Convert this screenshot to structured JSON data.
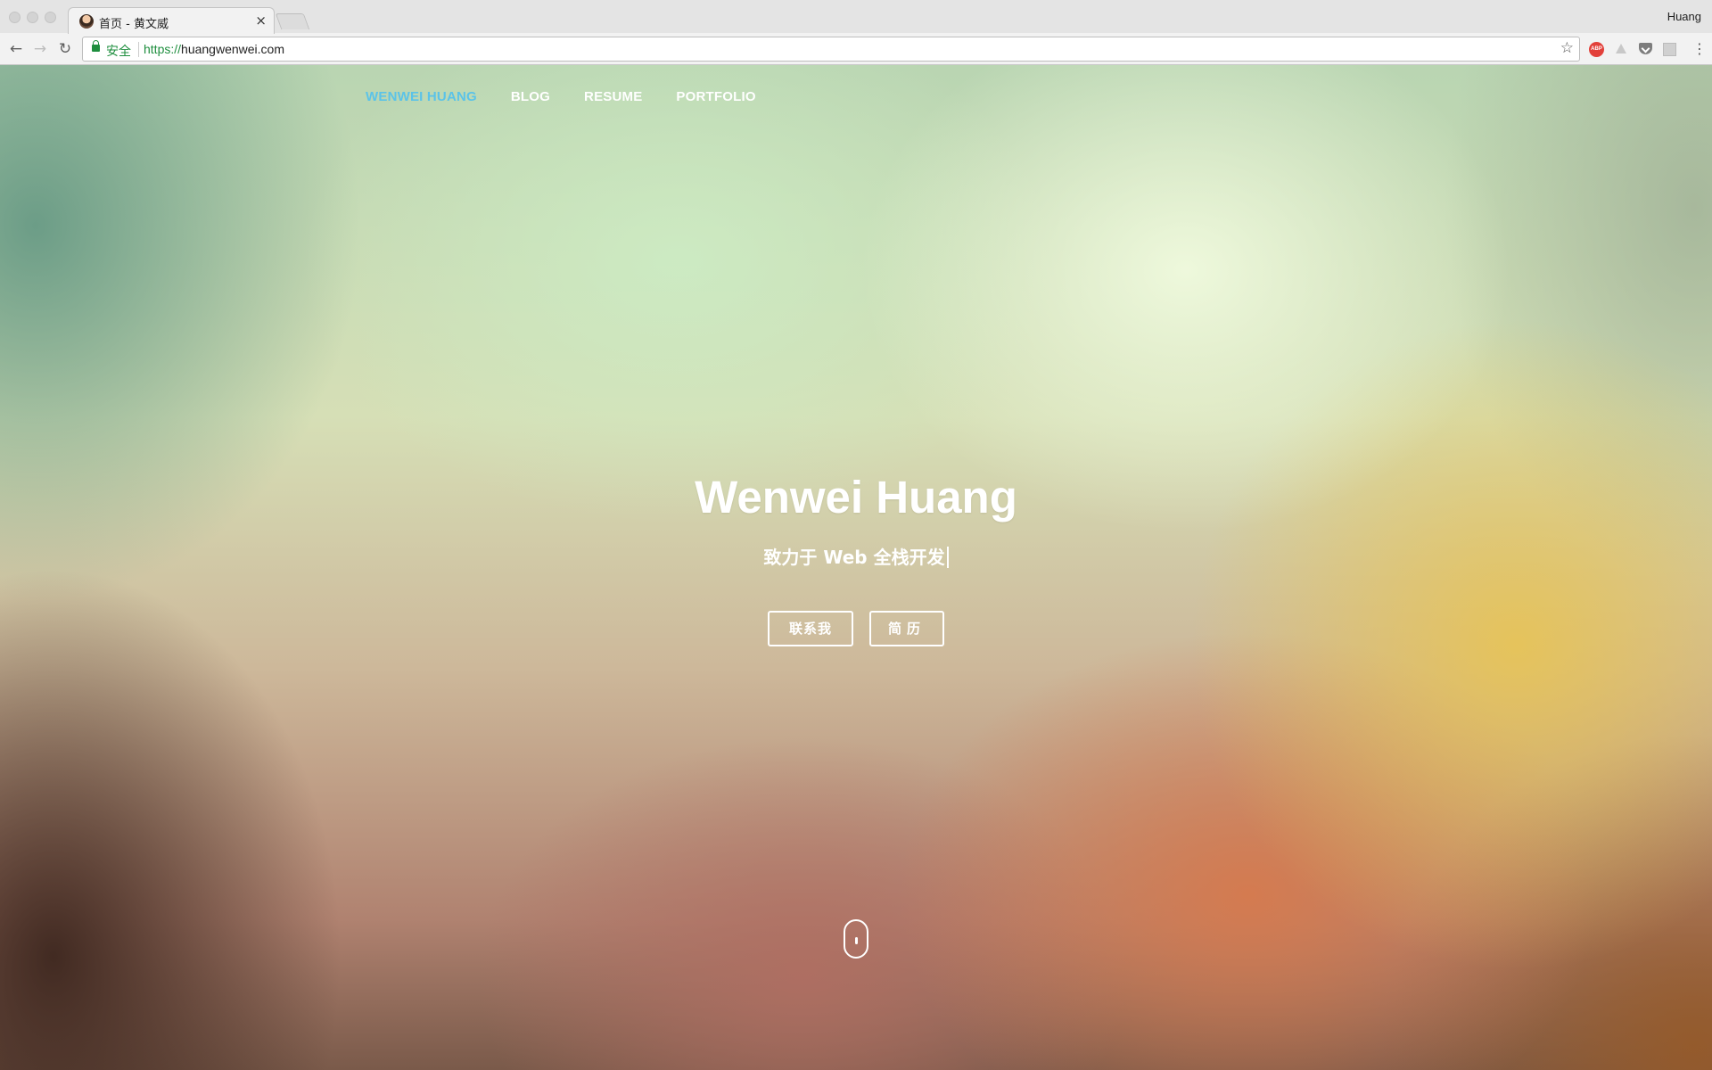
{
  "browser": {
    "tab_title": "首页 - 黄文威",
    "tab_close": "×",
    "profile_name": "Huang",
    "back_icon": "←",
    "forward_icon": "→",
    "reload_icon": "↻",
    "secure_label": "安全",
    "url_scheme": "https://",
    "url_host": "huangwenwei.com",
    "star_icon": "☆",
    "menu_icon": "⋮",
    "abp_label": "ABP"
  },
  "nav": {
    "items": [
      {
        "label": "WENWEI HUANG",
        "active": true
      },
      {
        "label": "BLOG",
        "active": false
      },
      {
        "label": "RESUME",
        "active": false
      },
      {
        "label": "PORTFOLIO",
        "active": false
      }
    ]
  },
  "hero": {
    "title": "Wenwei Huang",
    "subtitle": "致力于 Web 全栈开发",
    "buttons": {
      "contact": "联系我",
      "resume": "简历"
    }
  },
  "colors": {
    "nav_active": "#5bc3e8",
    "secure_green": "#1e8e3e"
  }
}
